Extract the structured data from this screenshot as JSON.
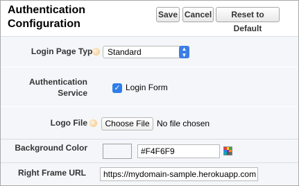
{
  "header": {
    "title": "Authentication Configuration",
    "save_label": "Save",
    "cancel_label": "Cancel",
    "reset_label": "Reset to Default"
  },
  "fields": {
    "login_page_type": {
      "label": "Login Page Type",
      "selected": "Standard"
    },
    "auth_service": {
      "label": "Authentication Service",
      "option": "Login Form",
      "checked": true
    },
    "logo_file": {
      "label": "Logo File",
      "button": "Choose File",
      "status": "No file chosen"
    },
    "background_color": {
      "label": "Background Color",
      "value": "#F4F6F9"
    },
    "right_frame_url": {
      "label": "Right Frame URL",
      "value": "https://mydomain-sample.herokuapp.com"
    }
  },
  "colors": {
    "panel_bg": "#f4f6f9",
    "checkbox": "#2f7ee8",
    "select_arrow": "#3b7ee6"
  }
}
